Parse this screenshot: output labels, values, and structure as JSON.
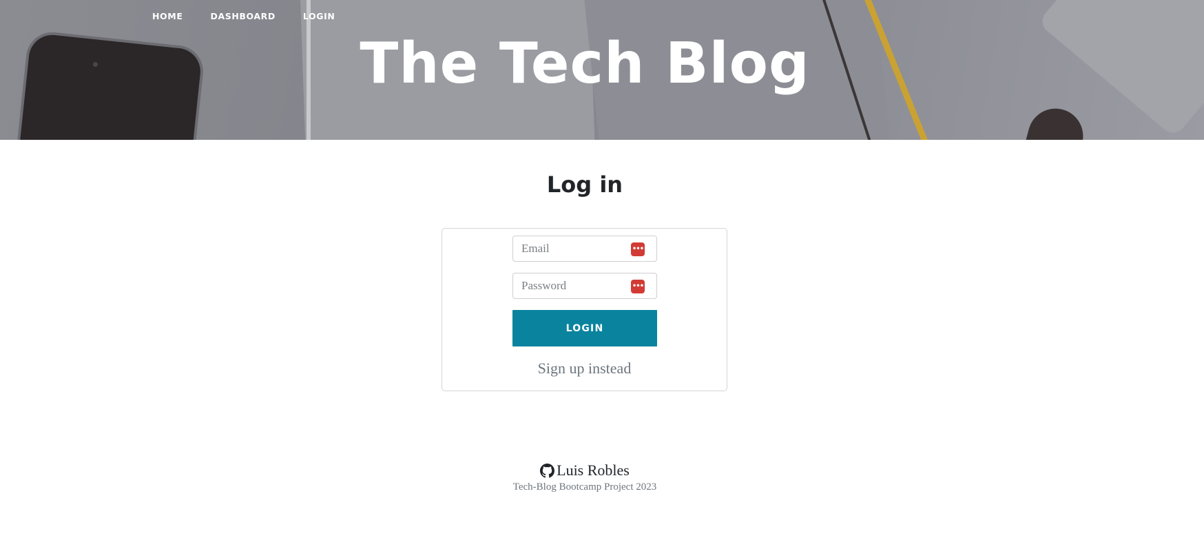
{
  "nav": {
    "items": [
      {
        "label": "HOME"
      },
      {
        "label": "DASHBOARD"
      },
      {
        "label": "LOGIN"
      }
    ]
  },
  "header": {
    "title": "The Tech Blog"
  },
  "login": {
    "heading": "Log in",
    "email_placeholder": "Email",
    "email_value": "",
    "password_placeholder": "Password",
    "password_value": "",
    "password_manager_icon": "password-manager-icon",
    "submit_label": "LOGIN",
    "signup_link": "Sign up instead"
  },
  "footer": {
    "author": "Luis Robles",
    "author_icon": "github-icon",
    "subtitle": "Tech-Blog Bootcamp Project 2023"
  },
  "colors": {
    "accent": "#0a849e",
    "password_manager_icon": "#d23b35",
    "muted_text": "#6c757d"
  }
}
